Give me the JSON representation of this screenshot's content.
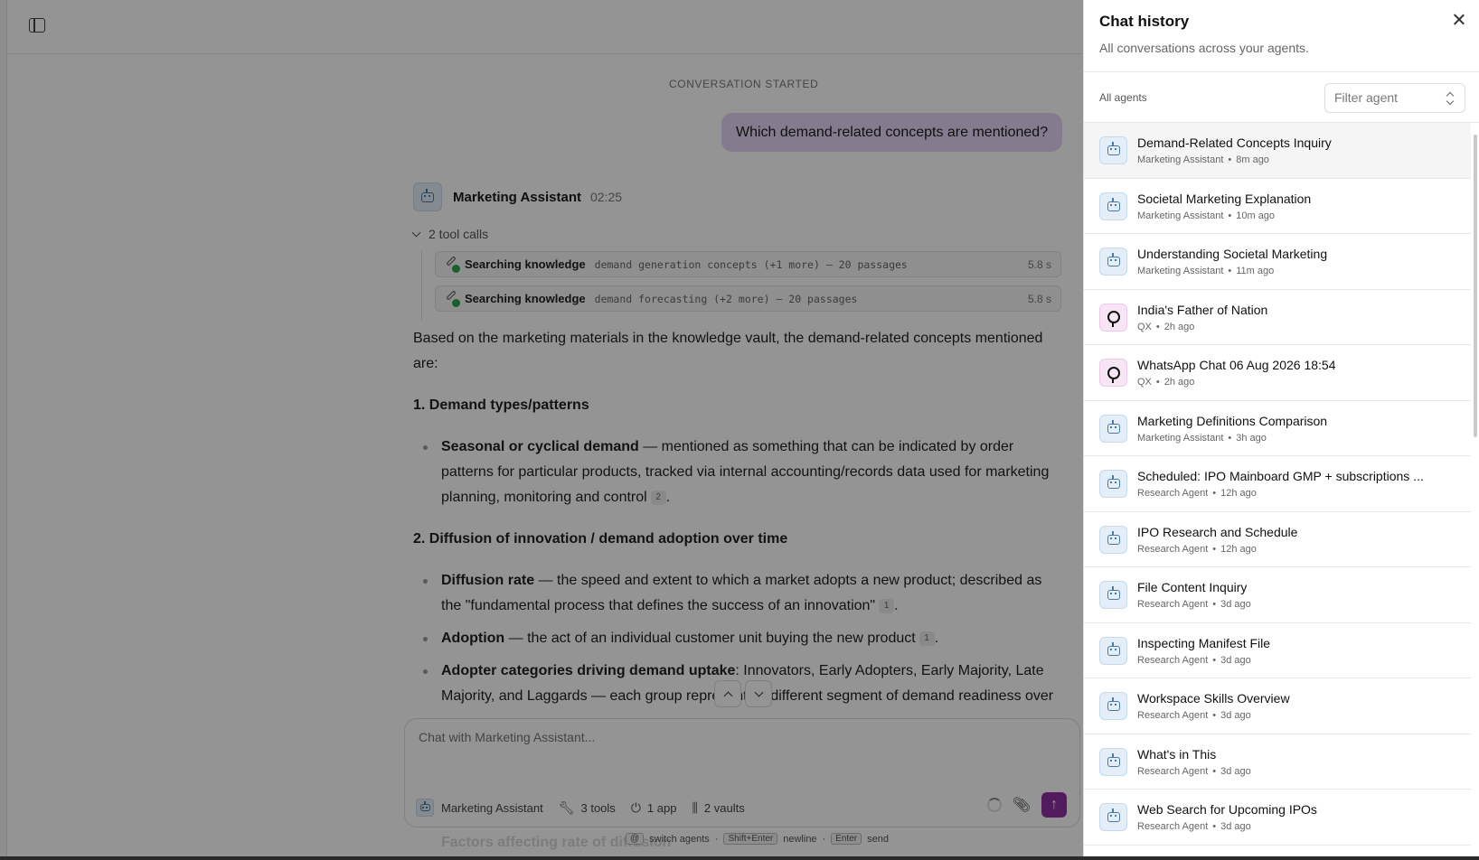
{
  "conversation": {
    "started_label": "CONVERSATION STARTED",
    "user_message": "Which demand-related concepts are mentioned?",
    "assistant": {
      "name": "Marketing Assistant",
      "time": "02:25"
    },
    "tool_calls_label": "2 tool calls",
    "tool_calls": [
      {
        "label": "Searching knowledge",
        "args": "demand generation concepts (+1 more) — 20 passages",
        "duration": "5.8 s"
      },
      {
        "label": "Searching knowledge",
        "args": "demand forecasting (+2 more) — 20 passages",
        "duration": "5.8 s"
      }
    ],
    "answer": {
      "intro": "Based on the marketing materials in the knowledge vault, the demand-related concepts mentioned are:",
      "section1_heading": "1. Demand types/patterns",
      "s1_b1_term": "Seasonal or cyclical demand",
      "s1_b1_text": " — mentioned as something that can be indicated by order patterns for particular products, tracked via internal accounting/records data used for marketing planning, monitoring and control",
      "s1_b1_cite": "2",
      "section2_heading": "2. Diffusion of innovation / demand adoption over time",
      "s2_b1_term": "Diffusion rate",
      "s2_b1_text": " — the speed and extent to which a market adopts a new product; described as the \"fundamental process that defines the success of an innovation\"",
      "s2_b1_cite": "1",
      "s2_b2_term": "Adoption",
      "s2_b2_text": " — the act of an individual customer unit buying the new product",
      "s2_b2_cite": "1",
      "s2_b3_term": "Adopter categories driving demand uptake",
      "s2_b3_text": ": Innovators, Early Adopters, Early Majority, Late Majority, and Laggards — each group represents a different segment of demand readiness over",
      "peek_text": "Factors affecting rate of diffusion"
    }
  },
  "composer": {
    "placeholder": "Chat with Marketing Assistant...",
    "agent": "Marketing Assistant",
    "tools": "3 tools",
    "apps": "1 app",
    "vaults": "2 vaults",
    "hint_key1": "@",
    "hint_text1": "switch agents",
    "hint_key2": "Shift+Enter",
    "hint_text2": "newline",
    "hint_key3": "Enter",
    "hint_text3": "send"
  },
  "panel": {
    "title": "Chat history",
    "subtitle": "All conversations across your agents.",
    "filter_label": "All agents",
    "filter_placeholder": "Filter agent",
    "items": [
      {
        "title": "Demand-Related Concepts Inquiry",
        "agent": "Marketing Assistant",
        "time": "8m ago",
        "icon": "robot-icon"
      },
      {
        "title": "Societal Marketing Explanation",
        "agent": "Marketing Assistant",
        "time": "10m ago",
        "icon": "robot-icon"
      },
      {
        "title": "Understanding Societal Marketing",
        "agent": "Marketing Assistant",
        "time": "11m ago",
        "icon": "robot-icon"
      },
      {
        "title": "India's Father of Nation",
        "agent": "QX",
        "time": "2h ago",
        "icon": "qx-icon"
      },
      {
        "title": "WhatsApp Chat 06 Aug 2026 18:54",
        "agent": "QX",
        "time": "2h ago",
        "icon": "qx-icon"
      },
      {
        "title": "Marketing Definitions Comparison",
        "agent": "Marketing Assistant",
        "time": "3h ago",
        "icon": "robot-icon"
      },
      {
        "title": "Scheduled: IPO Mainboard GMP + subscriptions ...",
        "agent": "Research Agent",
        "time": "12h ago",
        "icon": "robot-icon"
      },
      {
        "title": "IPO Research and Schedule",
        "agent": "Research Agent",
        "time": "12h ago",
        "icon": "robot-icon"
      },
      {
        "title": "File Content Inquiry",
        "agent": "Research Agent",
        "time": "3d ago",
        "icon": "robot-icon"
      },
      {
        "title": "Inspecting Manifest File",
        "agent": "Research Agent",
        "time": "3d ago",
        "icon": "robot-icon"
      },
      {
        "title": "Workspace Skills Overview",
        "agent": "Research Agent",
        "time": "3d ago",
        "icon": "robot-icon"
      },
      {
        "title": "What's in This",
        "agent": "Research Agent",
        "time": "3d ago",
        "icon": "robot-icon"
      },
      {
        "title": "Web Search for Upcoming IPOs",
        "agent": "Research Agent",
        "time": "3d ago",
        "icon": "robot-icon"
      }
    ]
  },
  "colors": {
    "accent": "#8e2fa0",
    "user_bubble": "#e5d5f5",
    "bot_icon_bg": "#e3eef8",
    "qx_icon_bg": "#f7e4f5"
  }
}
